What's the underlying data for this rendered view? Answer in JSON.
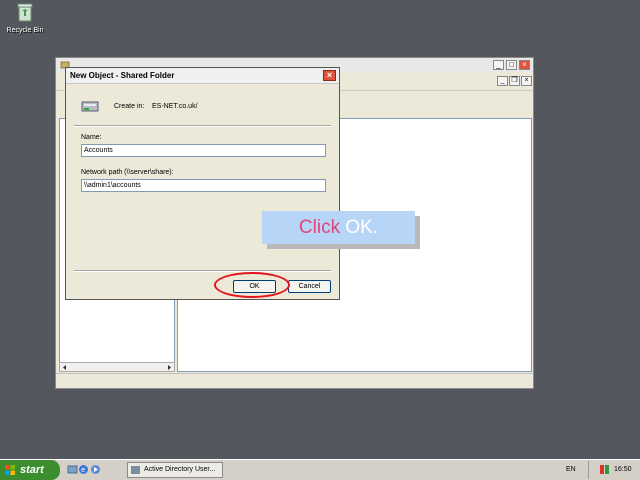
{
  "desktop": {
    "recycle_bin_label": "Recycle Bin",
    "recycle_icon": "recycle-bin-icon"
  },
  "mmc_window": {
    "window_buttons": [
      "_",
      "□",
      "×"
    ],
    "inner_buttons": [
      "_",
      "❐",
      "×"
    ]
  },
  "dialog": {
    "title": "New Object - Shared Folder",
    "close_glyph": "×",
    "create_in_label": "Create in:",
    "create_in_value": "ES-NET.co.uk/",
    "name_label": "Name:",
    "name_value": "Accounts",
    "path_label": "Network path (\\\\server\\share):",
    "path_value": "\\\\admin1\\accounts",
    "ok_label": "OK",
    "cancel_label": "Cancel"
  },
  "callout": {
    "word1": "Click",
    "word2": "OK."
  },
  "taskbar": {
    "start_label": "start",
    "task_label": "Active Directory User...",
    "language": "EN",
    "clock": "16:50"
  },
  "colors": {
    "desktop": "#55575e",
    "callout_bg": "#b7d5f6",
    "callout_text_pink": "#e0457b",
    "highlight_ring": "#e2161e",
    "start_green": "#3c8d2e"
  }
}
